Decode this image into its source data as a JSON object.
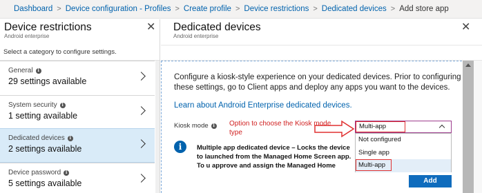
{
  "breadcrumb": {
    "items": [
      "Dashboard",
      "Device configuration - Profiles",
      "Create profile",
      "Device restrictions",
      "Dedicated devices",
      "Add store app"
    ]
  },
  "left_blade": {
    "title": "Device restrictions",
    "subtitle": "Android enterprise",
    "hint": "Select a category to configure settings.",
    "categories": [
      {
        "label": "General",
        "count": "29 settings available"
      },
      {
        "label": "System security",
        "count": "1 setting available"
      },
      {
        "label": "Dedicated devices",
        "count": "2 settings available"
      },
      {
        "label": "Device password",
        "count": "5 settings available"
      }
    ]
  },
  "right_blade": {
    "title": "Dedicated devices",
    "subtitle": "Android enterprise",
    "description": "Configure a kiosk-style experience on your dedicated devices. Prior to configuring these settings, go to Client apps and deploy any apps you want to the devices.",
    "learn_link": "Learn about Android Enterprise dedicated devices.",
    "kiosk_label": "Kiosk mode",
    "annotation": "Option to choose the Kiosk mode type",
    "dropdown_value": "Multi-app",
    "options": [
      "Not configured",
      "Single app",
      "Multi-app"
    ],
    "info_text": "Multiple app dedicated device – Locks the device to launched from the Managed Home Screen app. To u approve and assign the Managed Home Screen app",
    "add_button": "Add"
  },
  "colors": {
    "accent": "#0062ad",
    "annotation": "#d02020",
    "selected_bg": "#d9ebf8"
  }
}
